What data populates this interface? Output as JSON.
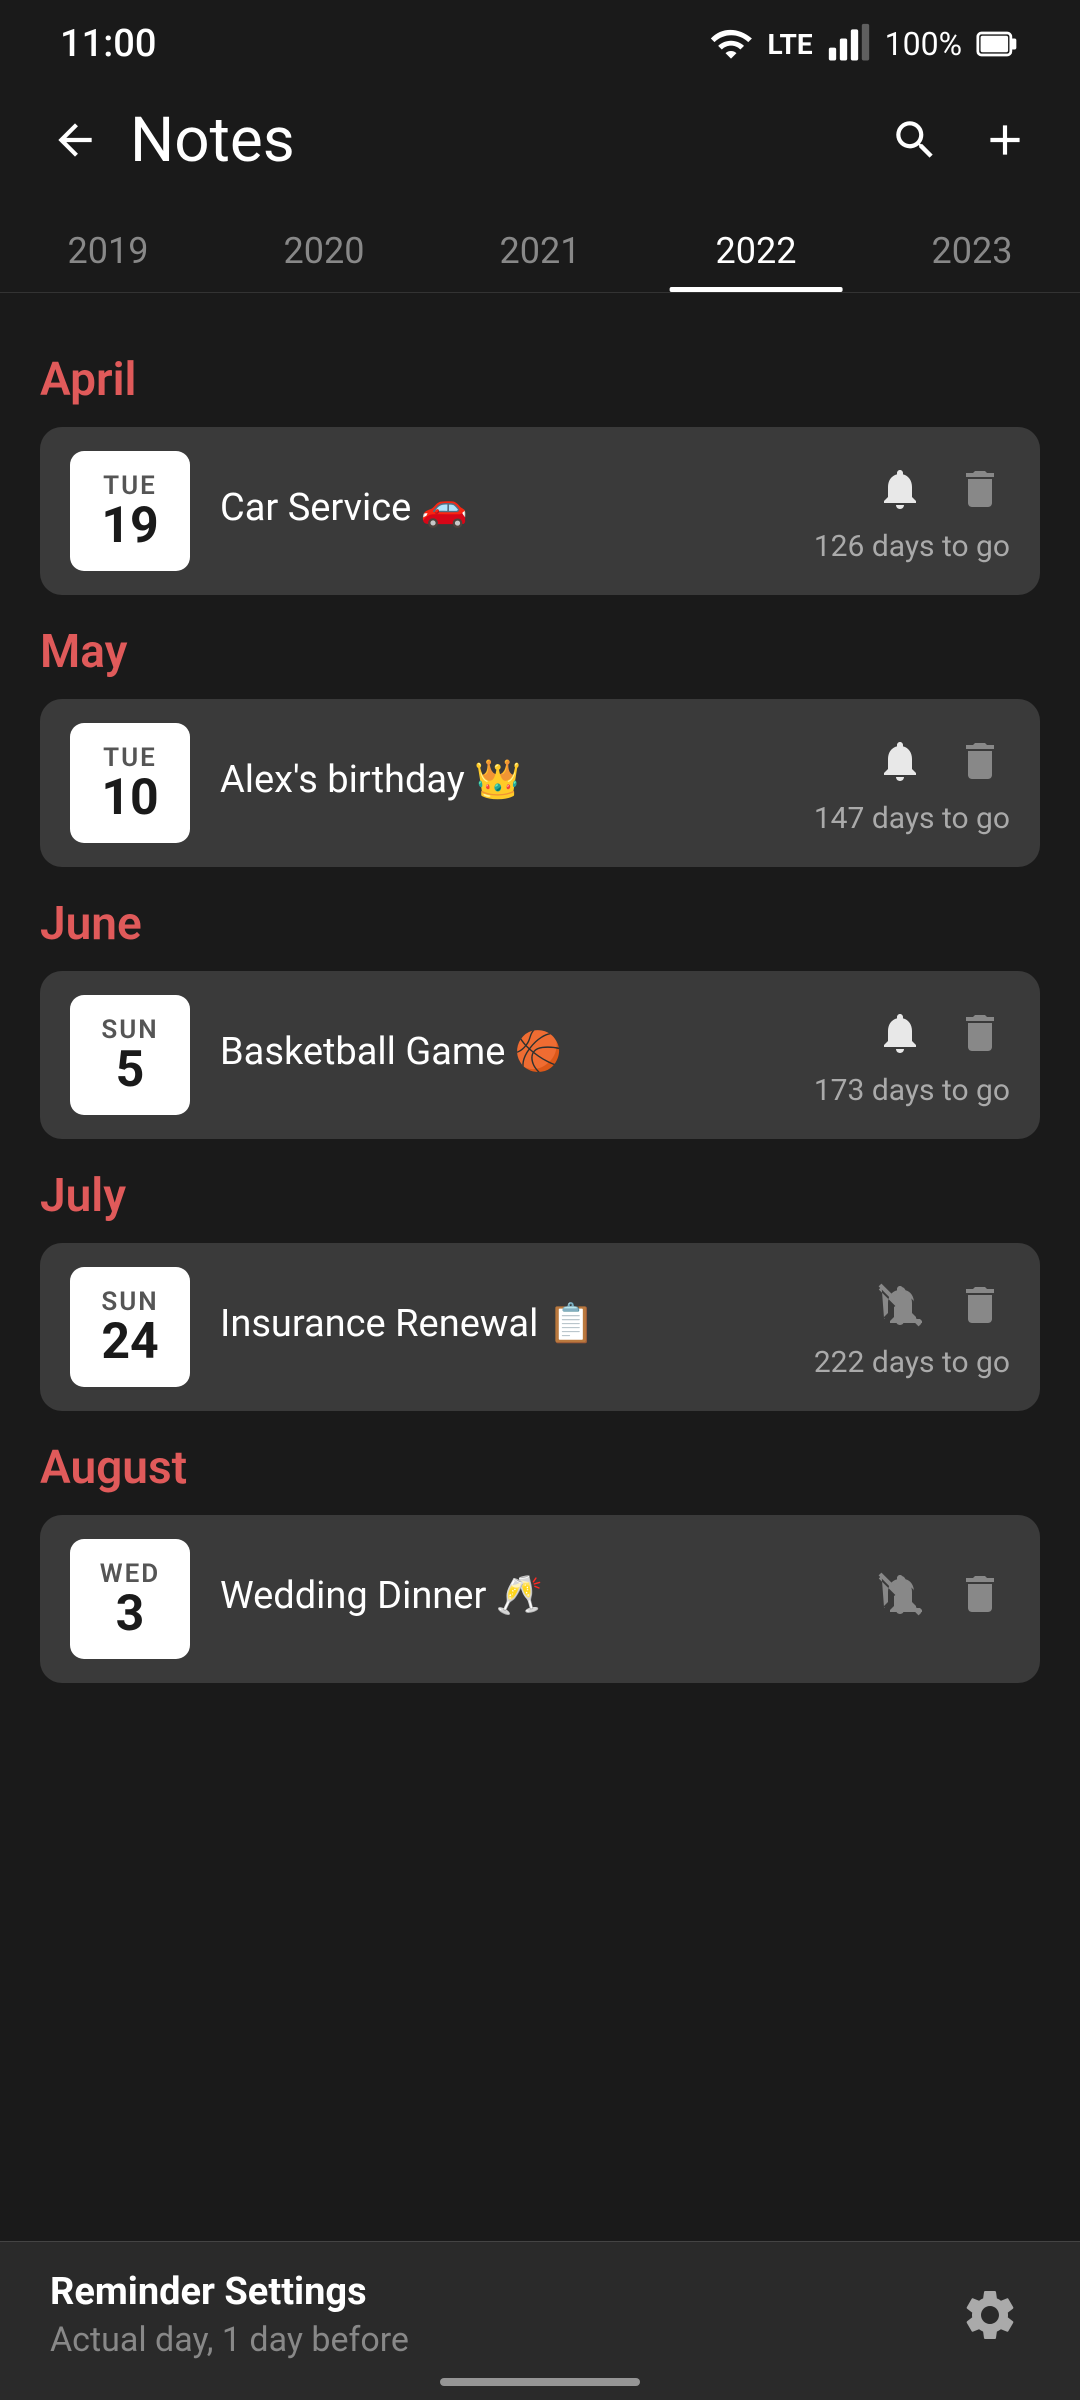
{
  "statusBar": {
    "time": "11:00",
    "battery": "100%"
  },
  "appBar": {
    "title": "Notes",
    "searchLabel": "search",
    "addLabel": "add"
  },
  "yearTabs": {
    "years": [
      "2019",
      "2020",
      "2021",
      "2022",
      "2023"
    ],
    "activeYear": "2022"
  },
  "sections": [
    {
      "month": "April",
      "notes": [
        {
          "dayName": "TUE",
          "dayNum": "19",
          "title": "Car Service 🚗",
          "daysToGo": "126 days to go",
          "bellActive": true,
          "id": "car-service"
        }
      ]
    },
    {
      "month": "May",
      "notes": [
        {
          "dayName": "TUE",
          "dayNum": "10",
          "title": "Alex's birthday 👑",
          "daysToGo": "147 days to go",
          "bellActive": true,
          "id": "alexs-birthday"
        }
      ]
    },
    {
      "month": "June",
      "notes": [
        {
          "dayName": "SUN",
          "dayNum": "5",
          "title": "Basketball Game 🏀",
          "daysToGo": "173 days to go",
          "bellActive": true,
          "id": "basketball-game"
        }
      ]
    },
    {
      "month": "July",
      "notes": [
        {
          "dayName": "SUN",
          "dayNum": "24",
          "title": "Insurance Renewal 📋",
          "daysToGo": "222 days to go",
          "bellActive": false,
          "id": "insurance-renewal"
        }
      ]
    },
    {
      "month": "August",
      "notes": [
        {
          "dayName": "WED",
          "dayNum": "3",
          "title": "Wedding Dinner 🥂",
          "daysToGo": "",
          "bellActive": false,
          "id": "wedding-dinner"
        }
      ]
    }
  ],
  "bottomBar": {
    "title": "Reminder Settings",
    "subtitle": "Actual day, 1 day before"
  }
}
